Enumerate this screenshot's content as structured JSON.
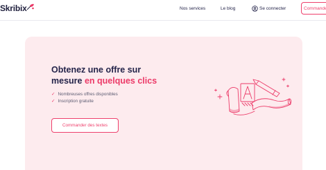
{
  "header": {
    "logo_text": "Skribix",
    "logo_icon": "quill-pen-icon",
    "nav": {
      "services": "Nos services",
      "blog": "Le blog",
      "login": "Se connecter",
      "login_icon": "user-circle-icon"
    },
    "cta": "Commander"
  },
  "hero": {
    "title_line1": "Obtenez une offre sur",
    "title_line2_plain": "mesure ",
    "title_line2_accent": "en quelques clics",
    "features": [
      "Nombreuses offres disponibles",
      "Inscription gratuite"
    ],
    "check_icon": "check-icon",
    "button": "Commander des textes",
    "illustration": "writing-tools-illustration"
  },
  "colors": {
    "accent": "#ec3a68",
    "hero_background": "#fdebee",
    "text_dark": "#24244a"
  }
}
